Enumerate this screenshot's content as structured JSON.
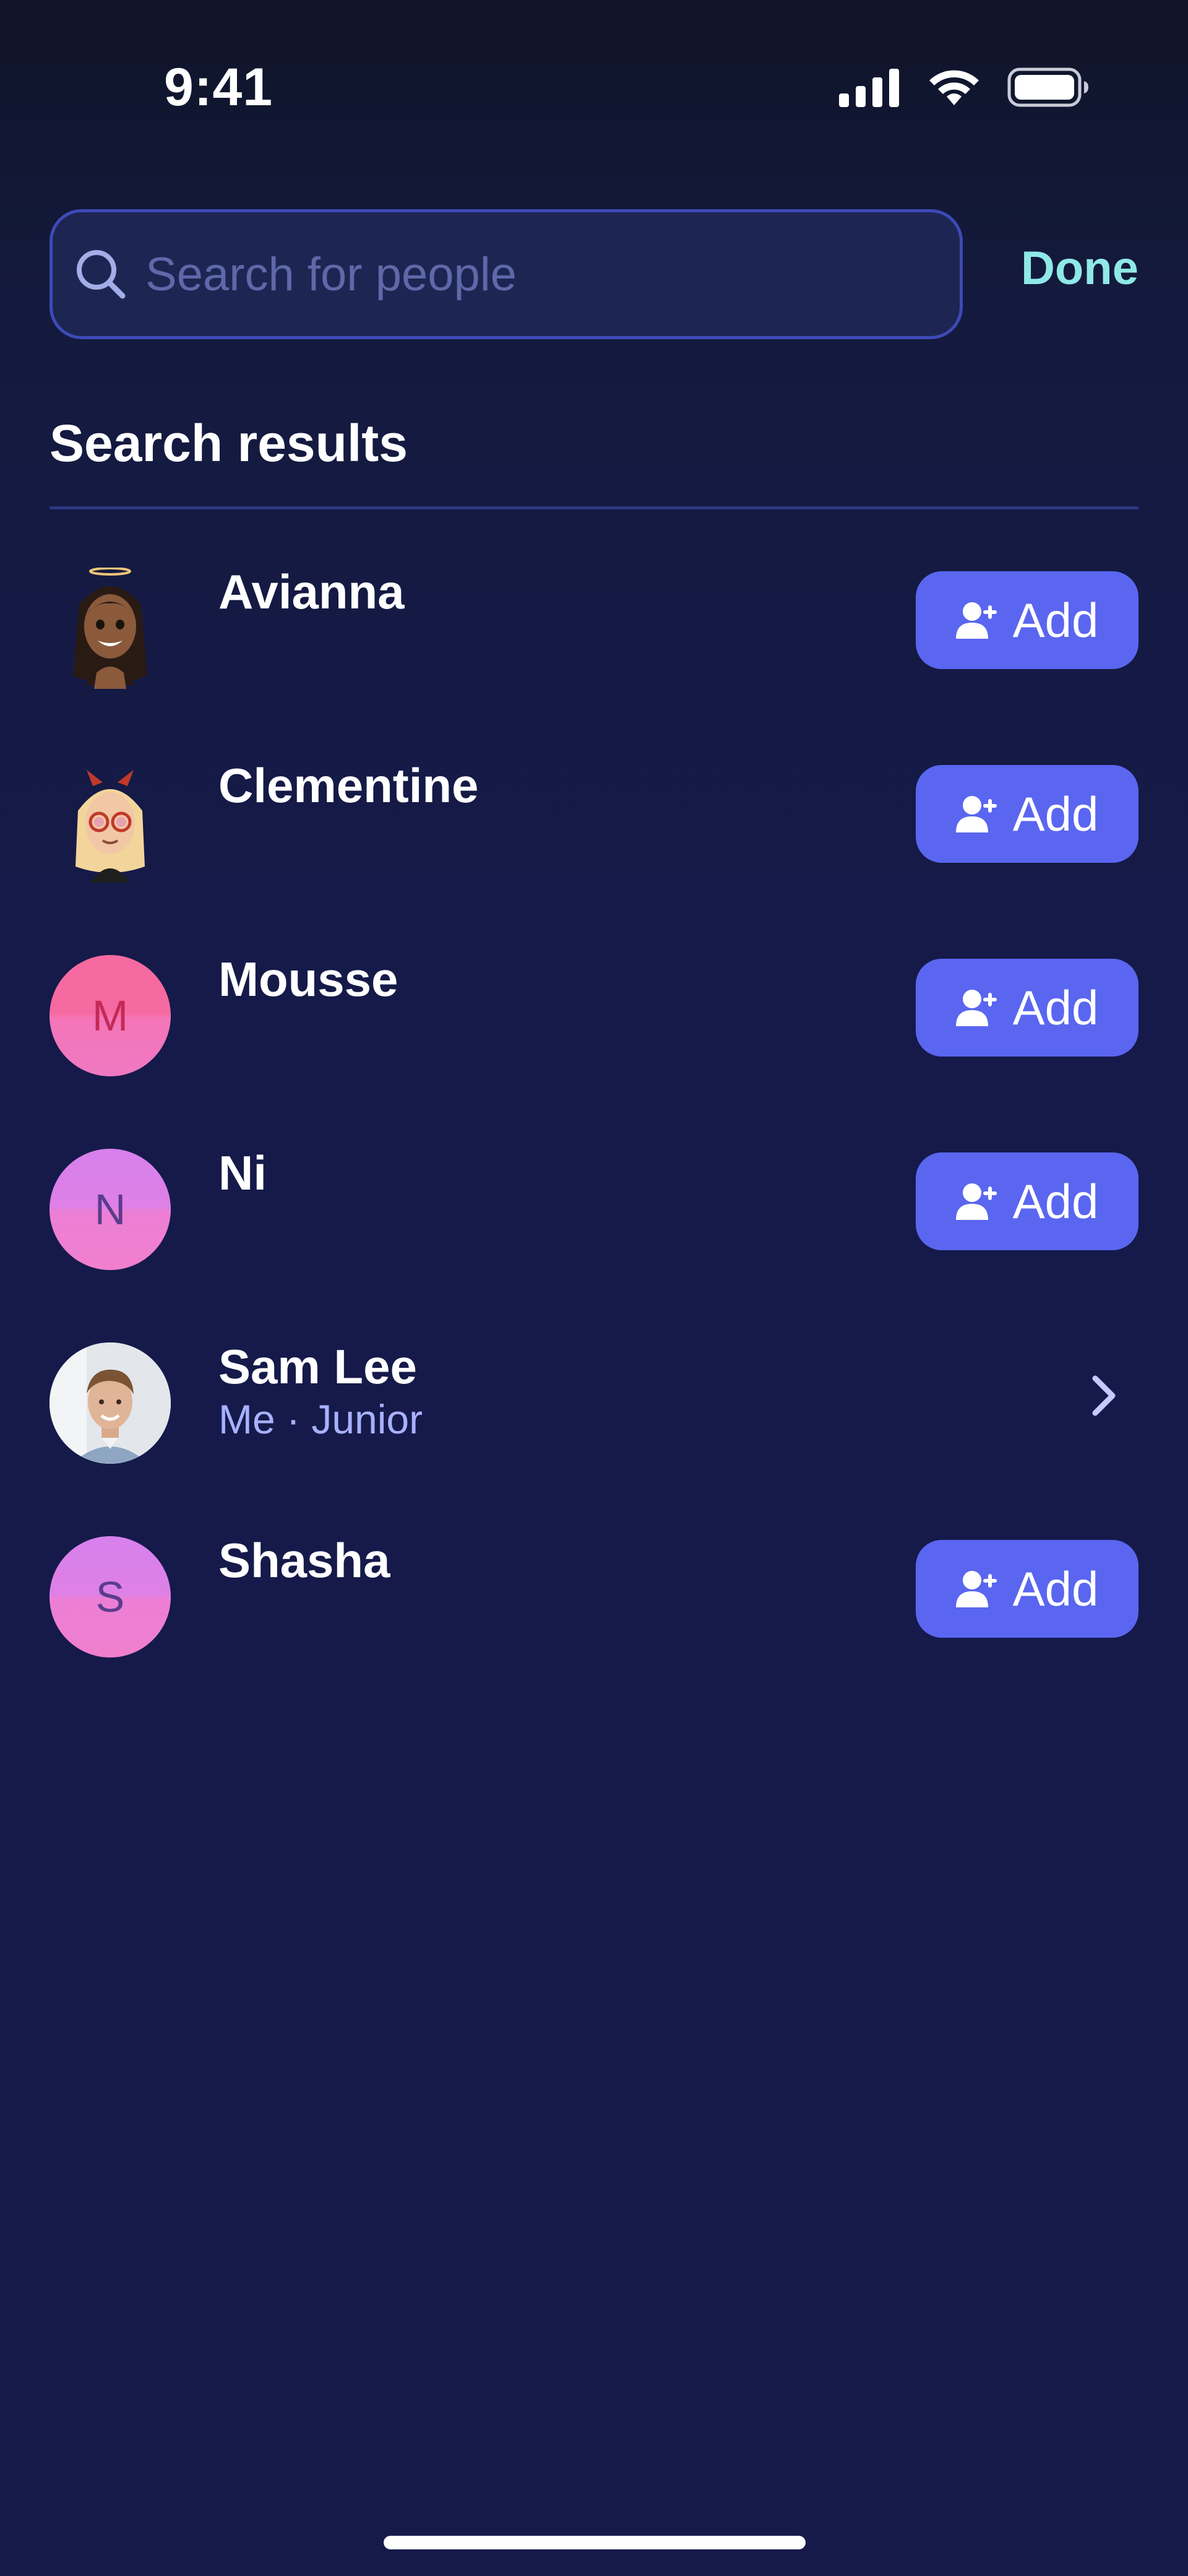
{
  "status_bar": {
    "time": "9:41",
    "icons": [
      "cellular-signal-icon",
      "wifi-icon",
      "battery-icon"
    ]
  },
  "search": {
    "placeholder": "Search for people",
    "value": "",
    "done_label": "Done"
  },
  "section_title": "Search results",
  "colors": {
    "accent": "#5a66f0",
    "done": "#8fe8e6",
    "subtitle": "#a7b1ff",
    "background": "#161a4b"
  },
  "results": [
    {
      "name": "Avianna",
      "subtitle": "",
      "avatar": "memoji-avianna",
      "action": "Add"
    },
    {
      "name": "Clementine",
      "subtitle": "",
      "avatar": "memoji-clementine",
      "action": "Add"
    },
    {
      "name": "Mousse",
      "subtitle": "",
      "avatar_letter": "M",
      "avatar": "letter-pink",
      "action": "Add"
    },
    {
      "name": "Ni",
      "subtitle": "",
      "avatar_letter": "N",
      "avatar": "letter-purple",
      "action": "Add"
    },
    {
      "name": "Sam Lee",
      "subtitle": "Me · Junior",
      "avatar": "photo-sam-lee",
      "action": "chevron-right-icon"
    },
    {
      "name": "Shasha",
      "subtitle": "",
      "avatar_letter": "S",
      "avatar": "letter-purple",
      "action": "Add"
    }
  ]
}
